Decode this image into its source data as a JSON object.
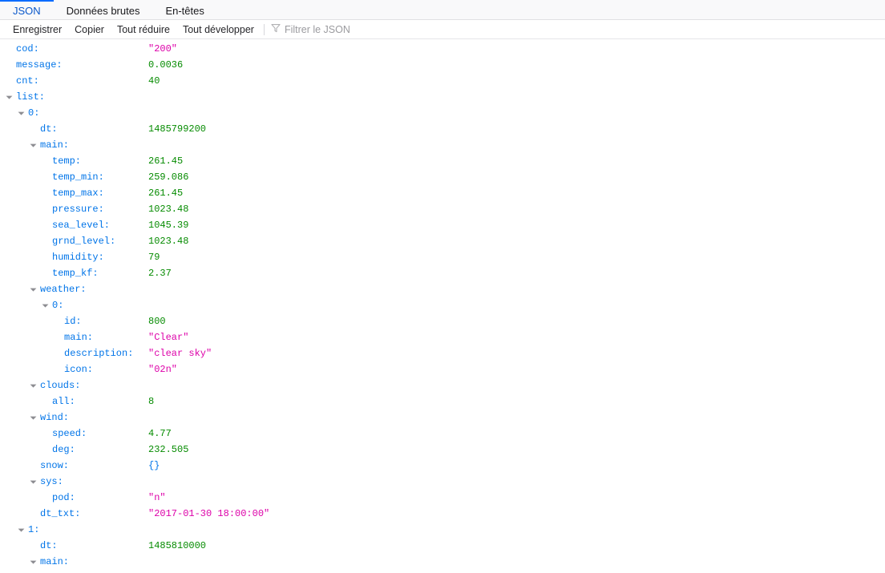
{
  "tabs": [
    {
      "label": "JSON",
      "active": true,
      "name": "tab-json"
    },
    {
      "label": "Données brutes",
      "active": false,
      "name": "tab-raw-data"
    },
    {
      "label": "En-têtes",
      "active": false,
      "name": "tab-headers"
    }
  ],
  "toolbar": {
    "save_label": "Enregistrer",
    "copy_label": "Copier",
    "collapse_all_label": "Tout réduire",
    "expand_all_label": "Tout développer",
    "filter_placeholder": "Filtrer le JSON",
    "filter_value": "",
    "filter_icon": "funnel-icon"
  },
  "colors": {
    "key": "#0074e8",
    "number": "#058b00",
    "string": "#dd00a9",
    "accent": "#0a6cff",
    "tabbar_bg": "#f9f9fa"
  },
  "json_rows": [
    {
      "depth": 1,
      "twisty": "",
      "key": "cod:",
      "value": "\"200\"",
      "type": "string"
    },
    {
      "depth": 1,
      "twisty": "",
      "key": "message:",
      "value": "0.0036",
      "type": "number"
    },
    {
      "depth": 1,
      "twisty": "",
      "key": "cnt:",
      "value": "40",
      "type": "number"
    },
    {
      "depth": 1,
      "twisty": "open",
      "key": "list:",
      "value": "",
      "type": "none"
    },
    {
      "depth": 2,
      "twisty": "open",
      "key": "0:",
      "value": "",
      "type": "none"
    },
    {
      "depth": 3,
      "twisty": "",
      "key": "dt:",
      "value": "1485799200",
      "type": "number"
    },
    {
      "depth": 3,
      "twisty": "open",
      "key": "main:",
      "value": "",
      "type": "none"
    },
    {
      "depth": 4,
      "twisty": "",
      "key": "temp:",
      "value": "261.45",
      "type": "number"
    },
    {
      "depth": 4,
      "twisty": "",
      "key": "temp_min:",
      "value": "259.086",
      "type": "number"
    },
    {
      "depth": 4,
      "twisty": "",
      "key": "temp_max:",
      "value": "261.45",
      "type": "number"
    },
    {
      "depth": 4,
      "twisty": "",
      "key": "pressure:",
      "value": "1023.48",
      "type": "number"
    },
    {
      "depth": 4,
      "twisty": "",
      "key": "sea_level:",
      "value": "1045.39",
      "type": "number"
    },
    {
      "depth": 4,
      "twisty": "",
      "key": "grnd_level:",
      "value": "1023.48",
      "type": "number"
    },
    {
      "depth": 4,
      "twisty": "",
      "key": "humidity:",
      "value": "79",
      "type": "number"
    },
    {
      "depth": 4,
      "twisty": "",
      "key": "temp_kf:",
      "value": "2.37",
      "type": "number"
    },
    {
      "depth": 3,
      "twisty": "open",
      "key": "weather:",
      "value": "",
      "type": "none"
    },
    {
      "depth": 4,
      "twisty": "open",
      "key": "0:",
      "value": "",
      "type": "none"
    },
    {
      "depth": 5,
      "twisty": "",
      "key": "id:",
      "value": "800",
      "type": "number"
    },
    {
      "depth": 5,
      "twisty": "",
      "key": "main:",
      "value": "\"Clear\"",
      "type": "string"
    },
    {
      "depth": 5,
      "twisty": "",
      "key": "description:",
      "value": "\"clear sky\"",
      "type": "string"
    },
    {
      "depth": 5,
      "twisty": "",
      "key": "icon:",
      "value": "\"02n\"",
      "type": "string"
    },
    {
      "depth": 3,
      "twisty": "open",
      "key": "clouds:",
      "value": "",
      "type": "none"
    },
    {
      "depth": 4,
      "twisty": "",
      "key": "all:",
      "value": "8",
      "type": "number"
    },
    {
      "depth": 3,
      "twisty": "open",
      "key": "wind:",
      "value": "",
      "type": "none"
    },
    {
      "depth": 4,
      "twisty": "",
      "key": "speed:",
      "value": "4.77",
      "type": "number"
    },
    {
      "depth": 4,
      "twisty": "",
      "key": "deg:",
      "value": "232.505",
      "type": "number"
    },
    {
      "depth": 3,
      "twisty": "",
      "key": "snow:",
      "value": "{}",
      "type": "object"
    },
    {
      "depth": 3,
      "twisty": "open",
      "key": "sys:",
      "value": "",
      "type": "none"
    },
    {
      "depth": 4,
      "twisty": "",
      "key": "pod:",
      "value": "\"n\"",
      "type": "string"
    },
    {
      "depth": 3,
      "twisty": "",
      "key": "dt_txt:",
      "value": "\"2017-01-30 18:00:00\"",
      "type": "string"
    },
    {
      "depth": 2,
      "twisty": "open",
      "key": "1:",
      "value": "",
      "type": "none"
    },
    {
      "depth": 3,
      "twisty": "",
      "key": "dt:",
      "value": "1485810000",
      "type": "number"
    },
    {
      "depth": 3,
      "twisty": "open",
      "key": "main:",
      "value": "",
      "type": "none"
    }
  ]
}
